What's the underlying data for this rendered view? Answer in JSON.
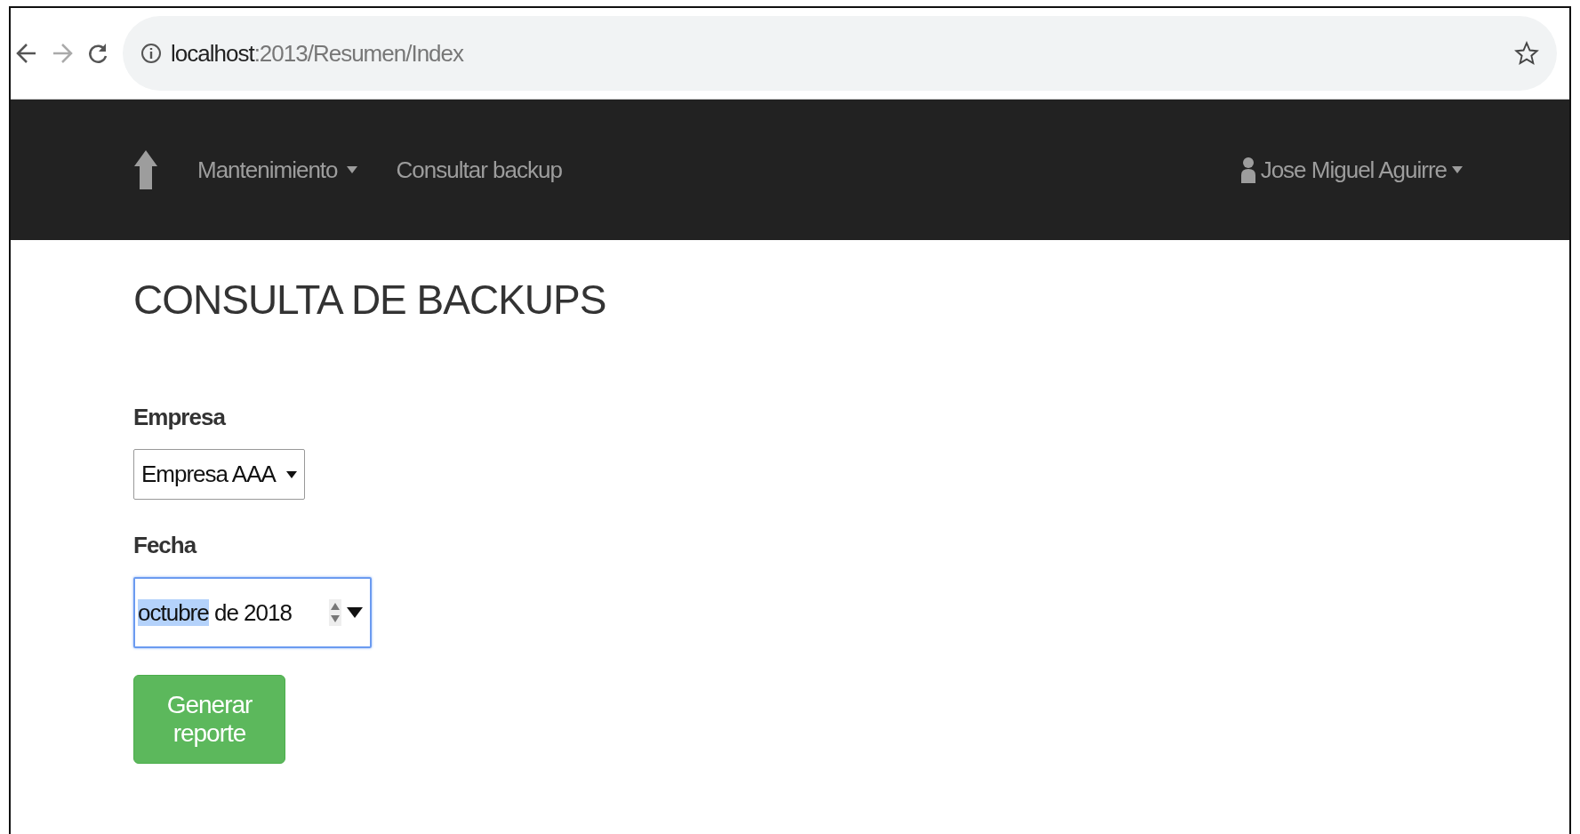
{
  "browser": {
    "address_host": "localhost",
    "address_path": ":2013/Resumen/Index"
  },
  "navbar": {
    "menu": [
      {
        "label": "Mantenimiento",
        "kind": "dropdown"
      },
      {
        "label": "Consultar backup",
        "kind": "link"
      }
    ],
    "user": {
      "label": "Jose Miguel Aguirre"
    }
  },
  "page": {
    "title": "CONSULTA DE BACKUPS",
    "fields": [
      {
        "kind": "select",
        "label": "Empresa",
        "value": "Empresa AAA",
        "focused": false
      },
      {
        "kind": "month",
        "label": "Fecha",
        "focused": true,
        "segments": [
          {
            "text": "octubre",
            "selected": true
          },
          {
            "text": "de 2018",
            "selected": false
          }
        ]
      }
    ],
    "button": "Generar reporte"
  }
}
